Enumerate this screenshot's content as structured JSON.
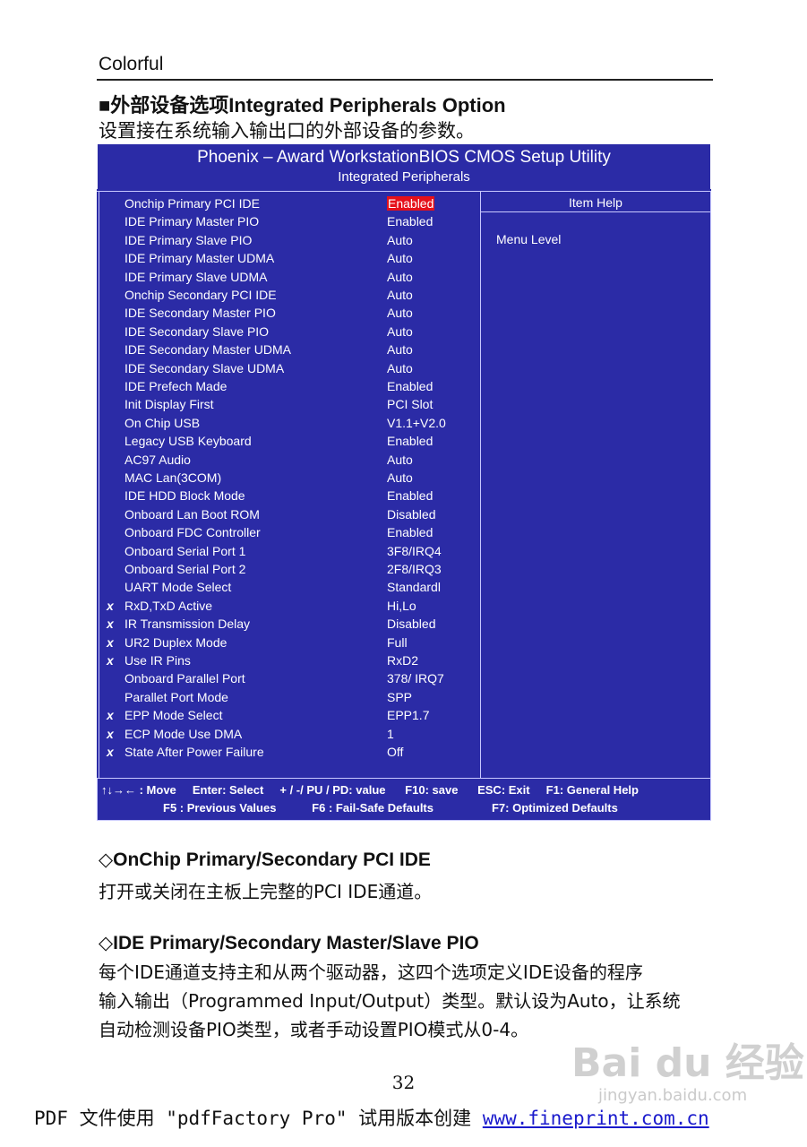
{
  "header": {
    "brand": "Colorful",
    "section_title": "■外部设备选项Integrated Peripherals Option",
    "section_subtitle": "设置接在系统输入输出口的外部设备的参数。"
  },
  "bios": {
    "title": "Phoenix – Award WorkstationBIOS CMOS Setup Utility",
    "subtitle": "Integrated Peripherals",
    "rows": [
      {
        "mark": "",
        "label": "Onchip Primary PCI IDE",
        "value": "Enabled"
      },
      {
        "mark": "",
        "label": "IDE Primary Master PIO",
        "value": "Enabled"
      },
      {
        "mark": "",
        "label": "IDE Primary Slave PIO",
        "value": "Auto"
      },
      {
        "mark": "",
        "label": "IDE Primary Master UDMA",
        "value": "Auto"
      },
      {
        "mark": "",
        "label": "IDE Primary Slave UDMA",
        "value": "Auto"
      },
      {
        "mark": "",
        "label": "Onchip Secondary PCI IDE",
        "value": "Auto"
      },
      {
        "mark": "",
        "label": "IDE Secondary Master PIO",
        "value": "Auto"
      },
      {
        "mark": "",
        "label": "IDE Secondary Slave PIO",
        "value": "Auto"
      },
      {
        "mark": "",
        "label": "IDE Secondary Master UDMA",
        "value": "Auto"
      },
      {
        "mark": "",
        "label": "IDE Secondary Slave UDMA",
        "value": "Auto"
      },
      {
        "mark": "",
        "label": "IDE Prefech Made",
        "value": "Enabled"
      },
      {
        "mark": "",
        "label": "Init Display First",
        "value": "PCI Slot"
      },
      {
        "mark": "",
        "label": "On Chip USB",
        "value": "V1.1+V2.0"
      },
      {
        "mark": "",
        "label": "Legacy USB Keyboard",
        "value": "Enabled"
      },
      {
        "mark": "",
        "label": "AC97 Audio",
        "value": "Auto"
      },
      {
        "mark": "",
        "label": "MAC Lan(3COM)",
        "value": "Auto"
      },
      {
        "mark": "",
        "label": "IDE HDD Block Mode",
        "value": "Enabled"
      },
      {
        "mark": "",
        "label": "Onboard Lan Boot ROM",
        "value": "Disabled"
      },
      {
        "mark": "",
        "label": "Onboard FDC Controller",
        "value": "Enabled"
      },
      {
        "mark": "",
        "label": "Onboard Serial Port 1",
        "value": "3F8/IRQ4"
      },
      {
        "mark": "",
        "label": "Onboard Serial Port 2",
        "value": "2F8/IRQ3"
      },
      {
        "mark": "",
        "label": "UART Mode Select",
        "value": "Standardl"
      },
      {
        "mark": "x",
        "label": "RxD,TxD    Active",
        "value": "Hi,Lo"
      },
      {
        "mark": "x",
        "label": "IR Transmission Delay",
        "value": "Disabled"
      },
      {
        "mark": "x",
        "label": "UR2 Duplex Mode",
        "value": "Full"
      },
      {
        "mark": "x",
        "label": "Use IR Pins",
        "value": "RxD2"
      },
      {
        "mark": "",
        "label": "Onboard Parallel Port",
        "value": "378/ IRQ7"
      },
      {
        "mark": "",
        "label": "Parallet Port Mode",
        "value": "SPP"
      },
      {
        "mark": "x",
        "label": "EPP Mode Select",
        "value": "EPP1.7"
      },
      {
        "mark": "x",
        "label": "ECP Mode Use DMA",
        "value": "1"
      },
      {
        "mark": "x",
        "label": "State After Power Failure",
        "value": "Off"
      }
    ],
    "help_title": "Item Help",
    "help_menu_level": "Menu Level",
    "footer_line1": "↑↓→← : Move     Enter: Select     + / -/ PU / PD: value      F10: save      ESC: Exit     F1: General Help",
    "footer_line2": "F5 : Previous Values           F6 : Fail-Safe Defaults                  F7: Optimized Defaults"
  },
  "sections": [
    {
      "heading": "◇OnChip Primary/Secondary PCI IDE",
      "body": "打开或关闭在主板上完整的PCI IDE通道。"
    },
    {
      "heading": "◇IDE Primary/Secondary Master/Slave PIO",
      "body_lines": [
        "每个IDE通道支持主和从两个驱动器，这四个选项定义IDE设备的程序",
        "输入输出（Programmed Input/Output）类型。默认设为Auto，让系统",
        "自动检测设备PIO类型，或者手动设置PIO模式从0-4。"
      ]
    }
  ],
  "page_number": "32",
  "watermark": {
    "logo": "Bai du 经验",
    "url": "jingyan.baidu.com"
  },
  "pdf_footer": {
    "text": "PDF 文件使用 \"pdfFactory Pro\" 试用版本创建 ",
    "link": "www.fineprint.com.cn"
  }
}
